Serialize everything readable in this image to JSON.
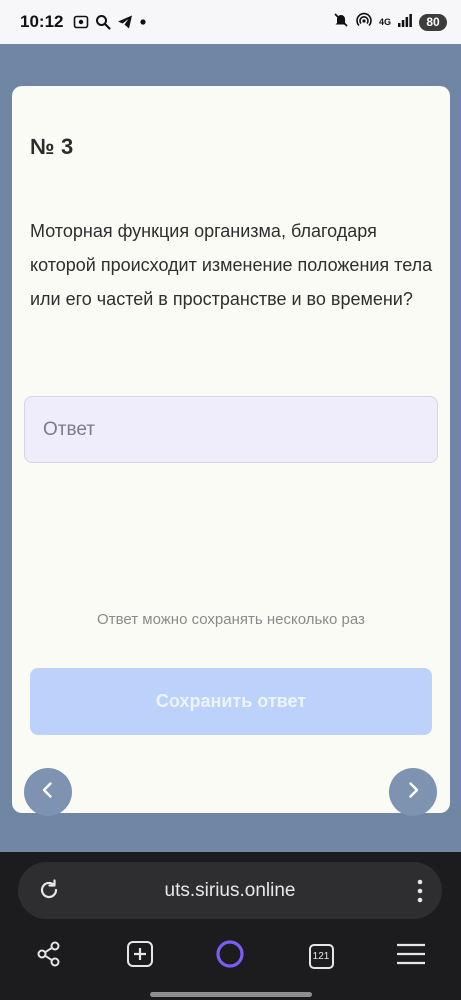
{
  "status_bar": {
    "time": "10:12",
    "network": "4G",
    "battery": "80"
  },
  "task": {
    "number": "№ 3",
    "question": "Моторная функция организма, благодаря которой происходит изменение положения тела или его частей в пространстве и во времени?",
    "answer": {
      "value": "",
      "placeholder": "Ответ"
    },
    "hint": "Ответ можно сохранять несколько раз",
    "save_label": "Сохранить ответ"
  },
  "browser": {
    "url": "uts.sirius.online",
    "tabs_count": "121"
  },
  "icons": {
    "prev": "chevron-left-icon",
    "next": "chevron-right-icon",
    "reload": "reload-icon",
    "menu": "kebab-icon",
    "share": "share-icon",
    "new_tab": "new-tab-icon",
    "assistant": "alice-icon",
    "hamburger": "hamburger-icon"
  },
  "colors": {
    "background": "#6f86a4",
    "card": "#fbfbf6",
    "save_button": "#bcd2fb",
    "input_background": "#efedfb",
    "assistant_accent": "#7b5cf5"
  }
}
